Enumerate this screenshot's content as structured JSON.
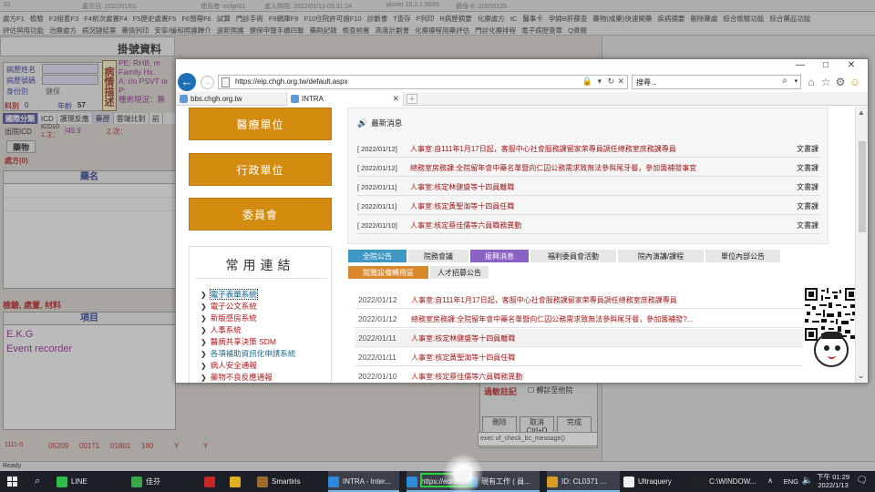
{
  "his": {
    "title_items": [
      "ID",
      "處方日: 2022/01/01",
      "使用者: eclgn01",
      "進入時間: 2022/01/13 03:31:24",
      "pisver 10.2.1.5695",
      "健保卡: 20050125"
    ],
    "menu_row1": [
      "處方F1",
      "檢驗",
      "F3組套F3",
      "F4前次處置F4",
      "F5歷史處置F5",
      "F6預帶F6",
      "試算",
      "門診手術",
      "F9網庫F9",
      "F10住院許可證F10",
      "診斷書",
      "T查存",
      "F列印",
      "R病歷摘要",
      "化療處方",
      "IC",
      "醫事卡",
      "孕婦B肝篩查",
      "藥物(成藥)快速開藥",
      "疾病摘要",
      "刪除藥處",
      "綜合檢驗功能",
      "綜合藥品功能"
    ],
    "menu_row2": [
      "評估與用功能",
      "治療處方",
      "病況鏈結案",
      "藥情列印",
      "安寧/緩和照護轉介",
      "遠距照護",
      "健保申報手續四聯",
      "藥刷記錄",
      "檢查前置",
      "高度計劃書",
      "化療療程用藥評估",
      "門診化療排程",
      "電子病歷簽章",
      "Q資閱"
    ],
    "header_title": "掛號資料",
    "patient_labels": [
      "病歷姓名",
      "病歷號碼",
      "身份別"
    ],
    "patient_identity": "健保",
    "ill_label": "病情描述",
    "ill_text": [
      "PE: RHB, m",
      "Family Hx.",
      "A: r/o PSVT or",
      "P:",
      "種術現況：無"
    ],
    "dept_label": "科別",
    "dept_value": "0",
    "age_label": "年齡",
    "age_value": "57",
    "dx_tabs": [
      "國際分類",
      "ICD",
      "護理反應",
      "藥歷",
      "雲端比對",
      "前"
    ],
    "dx_detail": [
      "出院ICD",
      "ICD10",
      "1.主：",
      "I49.9",
      "2.次："
    ],
    "drug_button": "藥物",
    "rx_label": "處方(0)",
    "rx_header": "藥名",
    "exam_title": "檢驗, 處置, 材料",
    "exam_header": "項目",
    "exam_items": [
      "E.K.G",
      "Event recorder"
    ],
    "status_values": [
      "1111-0",
      "05209",
      "00171",
      "01801",
      "180",
      "Y",
      "Y"
    ],
    "lower_title": "過敏註記",
    "lower_checkbox": "轉診至他院",
    "lower_buttons": [
      "刪除",
      "取消 Ctrl+D",
      "完成"
    ],
    "exec_field": "exec uf_check_bc_message()",
    "status_bar": "Ready"
  },
  "ie": {
    "window_controls": [
      "—",
      "□",
      "✕"
    ],
    "url": "https://eip.chgh.org.tw/default.aspx",
    "search_placeholder": "搜尋...",
    "tabs": [
      {
        "label": "bbs.chgh.org.tw",
        "active": false
      },
      {
        "label": "INTRA",
        "active": true
      }
    ],
    "unit_buttons": [
      "醫療單位",
      "行政單位",
      "委員會"
    ],
    "links_title": "常用連結",
    "links": [
      {
        "label": "電子表單系統",
        "selected": true,
        "color": "blue"
      },
      {
        "label": "電子公文系統",
        "selected": false,
        "color": "red"
      },
      {
        "label": "新版感房系統",
        "selected": false,
        "color": "red"
      },
      {
        "label": "人事系統",
        "selected": false,
        "color": "red"
      },
      {
        "label": "醫病共享決策 SDM",
        "selected": false,
        "color": "red"
      },
      {
        "label": "各項補助資訊化申請系統",
        "selected": false,
        "color": "blue"
      },
      {
        "label": "病人安全通報",
        "selected": false,
        "color": "red"
      },
      {
        "label": "藥物不良反應通報",
        "selected": false,
        "color": "red"
      }
    ],
    "news_title": "最新消息",
    "news": [
      {
        "date": "[ 2022/01/12]",
        "title": "人事室:自111年1月17日起，客服中心社會服務課留家荣專員調任總務室庶務課專員",
        "source": "文書課"
      },
      {
        "date": "[ 2022/01/12]",
        "title": "總務室房務課:全院留年會中藥名單暨向仁囚公務需求致無法參與尾牙餐，參加籌補發事宜",
        "source": "文書課"
      },
      {
        "date": "[ 2022/01/11]",
        "title": "人事室:核定林健盛等十四員離職",
        "source": "文書課"
      },
      {
        "date": "[ 2022/01/11]",
        "title": "人事室:核定黃聖洳等十四員任職",
        "source": "文書課"
      },
      {
        "date": "[ 2022/01/10]",
        "title": "人事室:核定蔡佳儒等六員職務異動",
        "source": "文書課"
      }
    ],
    "ann_tabs_row1": [
      {
        "label": "全院公告",
        "style": "teal"
      },
      {
        "label": "院務會議",
        "style": "plain"
      },
      {
        "label": "振興消息",
        "style": "purple"
      },
      {
        "label": "福利委員會活動",
        "style": "plain"
      },
      {
        "label": "院內演講/課程",
        "style": "plain"
      },
      {
        "label": "單位內部公告",
        "style": "plain"
      }
    ],
    "ann_tabs_row2": [
      {
        "label": "閱覽設備轉用區",
        "style": "orange"
      },
      {
        "label": "人才招募公告",
        "style": "plain"
      }
    ],
    "announcements": [
      {
        "date": "2022/01/12",
        "title": "人事室:自111年1月17日起，客服中心社會服務課留家荣專員調任總務室庶務課專員"
      },
      {
        "date": "2022/01/12",
        "title": "總務室房務課:全院留年會中藥名單暨向仁囚公務需求致無法參與尾牙餐，參加籌補發?..."
      },
      {
        "date": "2022/01/11",
        "title": "人事室:核定林健盛等十四員離職"
      },
      {
        "date": "2022/01/11",
        "title": "人事室:核定黃聖洳等十四員任職"
      },
      {
        "date": "2022/01/10",
        "title": "人事室:核定蔡佳儒等六員職務異動"
      }
    ]
  },
  "taskbar": {
    "items": [
      {
        "label": "LINE",
        "icon": "line-icon",
        "color": "#2fbf4a"
      },
      {
        "label": "佳芬",
        "icon": "contact-icon",
        "color": "#3aa64a"
      },
      {
        "label": "",
        "icon": "hospital-app-icon",
        "color": "#c62828"
      },
      {
        "label": "",
        "icon": "chrome-icon",
        "color": "#e0b020"
      },
      {
        "label": "Smartiris",
        "icon": "smartiris-icon",
        "color": "#9c6a2a"
      },
      {
        "label": "INTRA - Inter...",
        "icon": "ie-icon",
        "color": "#2d8ad8"
      },
      {
        "label": "https://edoc...",
        "icon": "ie-icon",
        "color": "#2d8ad8"
      },
      {
        "label": "現有工作 ( 員...",
        "icon": "ie-icon",
        "color": "#2d8ad8"
      },
      {
        "label": "ID: CL0371 ...",
        "icon": "his-icon",
        "color": "#d89d20"
      },
      {
        "label": "Ultraquery",
        "icon": "ultraquery-icon",
        "color": "#f0f0f0"
      },
      {
        "label": "C:\\WINDOW...",
        "icon": "cmd-icon",
        "color": "#222222"
      }
    ],
    "lang": "ENG",
    "time": "下午 01:29",
    "date": "2022/1/13"
  },
  "colors": {
    "unit_button": "#d38c10",
    "tab_teal": "#3d98c4",
    "tab_purple": "#8a62c4",
    "tab_orange": "#d9892c",
    "news_red": "#a01818",
    "ie_blue": "#1f6fb7",
    "highlight_green": "#29d13a"
  }
}
